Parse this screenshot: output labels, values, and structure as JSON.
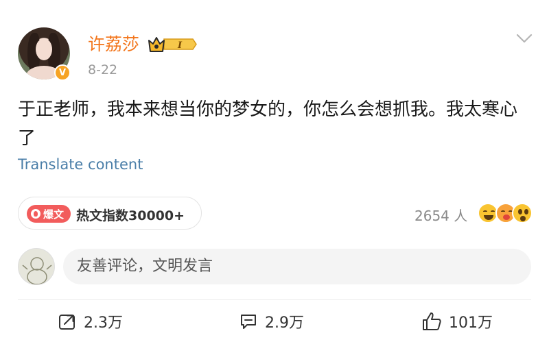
{
  "post": {
    "author": "许荔莎",
    "vip_level": "I",
    "date": "8-22",
    "text": "于正老师，我本来想当你的梦女的，你怎么会想抓我。我太寒心了",
    "translate_label": "Translate content"
  },
  "hot": {
    "tag": "爆文",
    "index": "热文指数30000+"
  },
  "reactions": {
    "count": "2654 人",
    "icons": [
      "laughing-emoji",
      "kiss-emoji",
      "surprised-emoji"
    ]
  },
  "comment_box": {
    "placeholder": "友善评论，文明发言"
  },
  "actions": {
    "repost_count": "2.3万",
    "comment_count": "2.9万",
    "like_count": "101万"
  },
  "colors": {
    "username": "#f3761c",
    "link": "#4a7ea8",
    "hot_tag": "#f25c5c",
    "verified": "#f6a324"
  }
}
